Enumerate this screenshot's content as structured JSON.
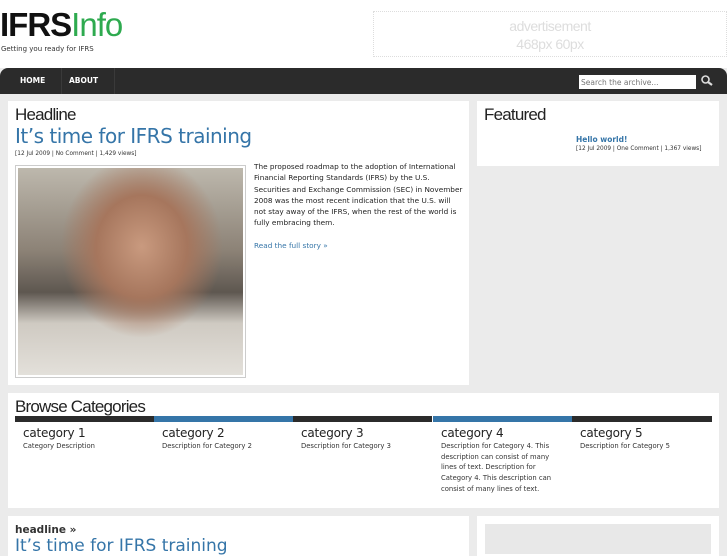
{
  "header": {
    "logo_bold": "IFRS",
    "logo_light": "Info",
    "tagline": "Getting you ready for IFRS",
    "ad_line1": "advertisement",
    "ad_line2": "468px 60px"
  },
  "nav": {
    "items": [
      "HOME",
      "ABOUT"
    ],
    "search_placeholder": "Search the archive...",
    "search_icon": "magnifier-icon"
  },
  "headline": {
    "section": "Headline",
    "title": "It’s time for IFRS training",
    "meta": "[12 Jul 2009 | No Comment | 1,429 views]",
    "excerpt": "The proposed roadmap to the adoption of International Financial Reporting Standards (IFRS) by the U.S. Securities and Exchange Commission (SEC) in November 2008 was the most recent indication that the U.S. will not stay away of the IFRS, when the rest of the world is fully embracing them.",
    "read_more": "Read the full story »"
  },
  "featured": {
    "section": "Featured",
    "title": "Hello world!",
    "meta": "[12 Jul 2009 | One Comment | 1,367 views]"
  },
  "browse": {
    "section": "Browse Categories",
    "categories": [
      {
        "name": "category 1",
        "desc": "Category Description",
        "color": "#2b2b2b"
      },
      {
        "name": "category 2",
        "desc": "Description for Category 2",
        "color": "#3575a8"
      },
      {
        "name": "category 3",
        "desc": "Description for Category 3",
        "color": "#2b2b2b"
      },
      {
        "name": "category 4",
        "desc": "Description for Category 4. This description can consist of many lines of text. Description for Category 4. This description can consist of many lines of text.",
        "color": "#3575a8"
      },
      {
        "name": "category 5",
        "desc": "Description for Category 5",
        "color": "#2b2b2b"
      }
    ]
  },
  "bottom": {
    "label": "headline »",
    "title": "It’s time for IFRS training"
  }
}
